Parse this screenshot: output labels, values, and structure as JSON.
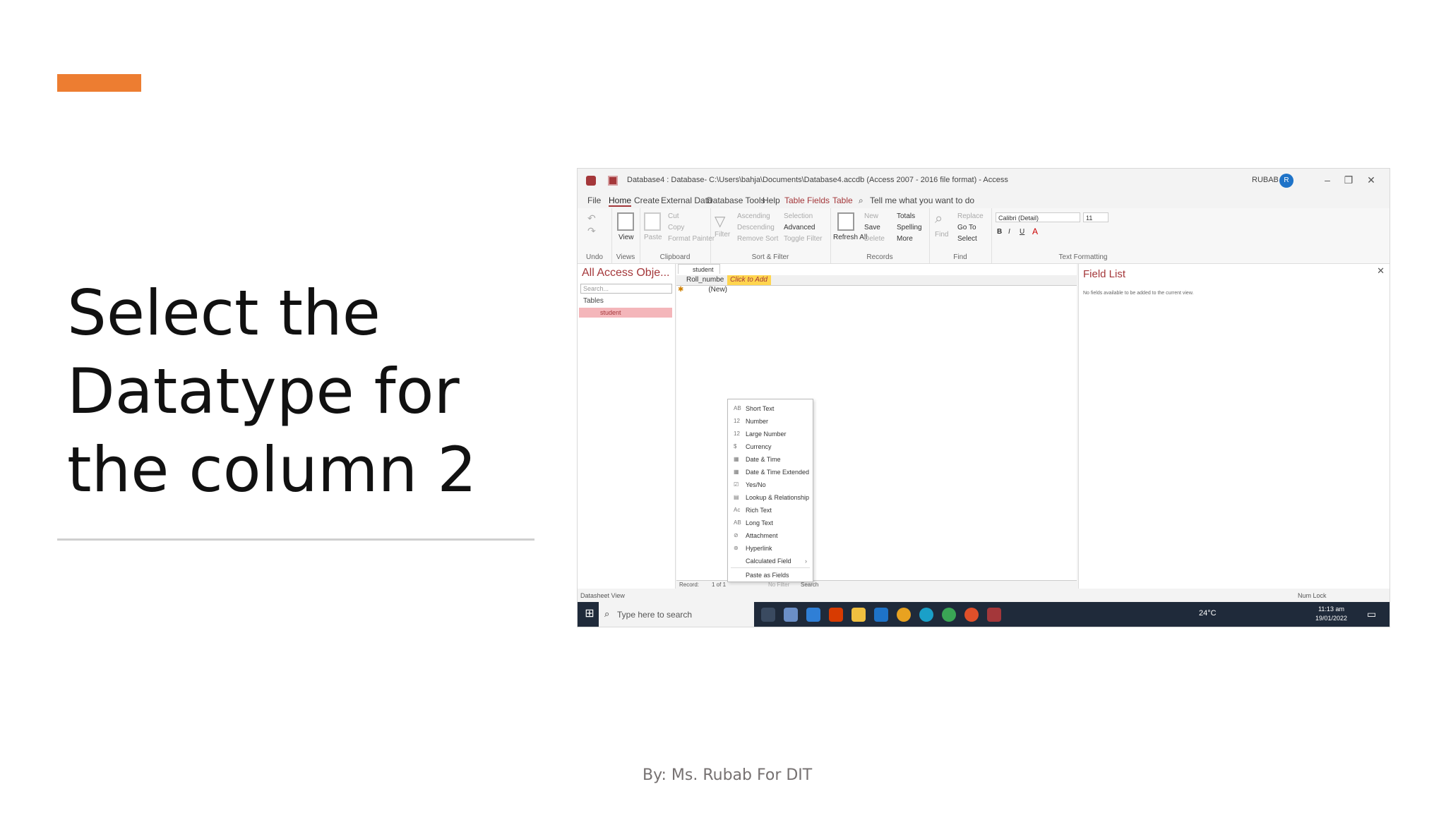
{
  "slide": {
    "title": "Select the Datatype for the column 2",
    "footer": "By: Ms. Rubab For DIT",
    "accent_color": "#ed7d31"
  },
  "window": {
    "title": "Database4 : Database- C:\\Users\\bahja\\Documents\\Database4.accdb (Access 2007 - 2016 file format) - Access",
    "user": "RUBAB",
    "avatar_initial": "R"
  },
  "menu": [
    "File",
    "Home",
    "Create",
    "External Data",
    "Database Tools",
    "Help",
    "Table Fields",
    "Table"
  ],
  "tell_me": "Tell me what you want to do",
  "ribbon": {
    "groups": [
      "Undo",
      "Views",
      "Clipboard",
      "Sort & Filter",
      "Records",
      "Find",
      "Text Formatting"
    ],
    "view": "View",
    "paste": "Paste",
    "cut": "Cut",
    "copy": "Copy",
    "format_painter": "Format Painter",
    "filter": "Filter",
    "ascending": "Ascending",
    "descending": "Descending",
    "remove_sort": "Remove Sort",
    "selection": "Selection",
    "advanced": "Advanced",
    "toggle_filter": "Toggle Filter",
    "refresh": "Refresh All",
    "new": "New",
    "save": "Save",
    "delete": "Delete",
    "totals": "Totals",
    "spelling": "Spelling",
    "more": "More",
    "find": "Find",
    "replace": "Replace",
    "goto": "Go To",
    "select": "Select",
    "font": "Calibri (Detail)",
    "font_size": "11"
  },
  "nav": {
    "title": "All Access Obje...",
    "search_placeholder": "Search...",
    "section": "Tables",
    "item": "student"
  },
  "doc": {
    "tab": "student",
    "col1": "Roll_numbe",
    "col2": "Click to Add",
    "new_row": "(New)"
  },
  "dropdown": [
    {
      "icon": "AB",
      "label": "Short Text"
    },
    {
      "icon": "12",
      "label": "Number"
    },
    {
      "icon": "12",
      "label": "Large Number"
    },
    {
      "icon": "$",
      "label": "Currency"
    },
    {
      "icon": "▦",
      "label": "Date & Time"
    },
    {
      "icon": "▦",
      "label": "Date & Time Extended"
    },
    {
      "icon": "☑",
      "label": "Yes/No"
    },
    {
      "icon": "▤",
      "label": "Lookup & Relationship"
    },
    {
      "icon": "Ac",
      "label": "Rich Text"
    },
    {
      "icon": "AB",
      "label": "Long Text"
    },
    {
      "icon": "⊘",
      "label": "Attachment"
    },
    {
      "icon": "⊛",
      "label": "Hyperlink"
    },
    {
      "icon": "",
      "label": "Calculated Field"
    },
    {
      "icon": "",
      "label": "Paste as Fields"
    }
  ],
  "field_list": {
    "title": "Field List",
    "message": "No fields available to be added to the current view."
  },
  "record_nav": {
    "label": "Record:",
    "position": "1 of 1",
    "filter": "No Filter",
    "search": "Search"
  },
  "status": {
    "left": "Datasheet View",
    "right": "Num Lock"
  },
  "taskbar": {
    "search_placeholder": "Type here to search",
    "weather": "24°C",
    "time": "11:13 am",
    "date": "19/01/2022"
  }
}
